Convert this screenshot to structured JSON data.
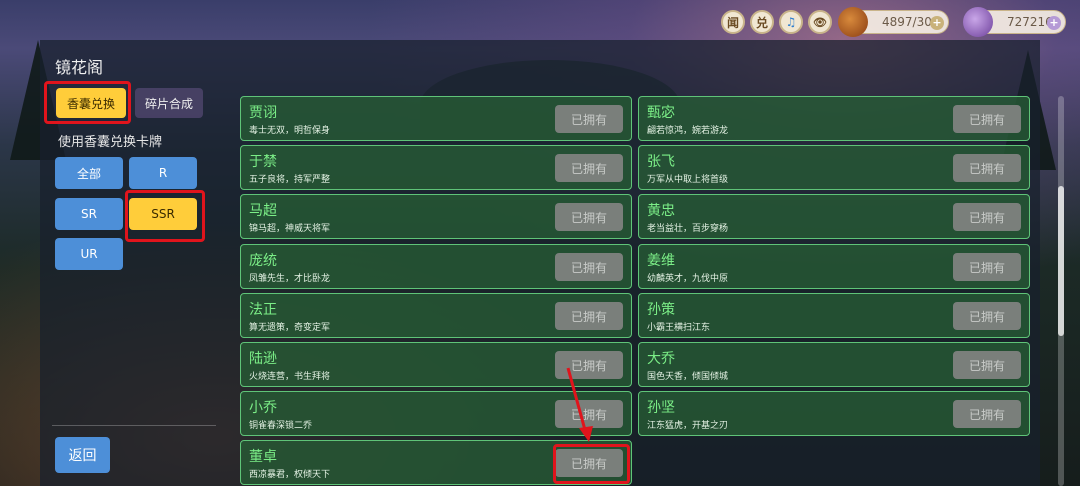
{
  "topbar": {
    "icons": [
      {
        "name": "news-icon",
        "glyph": "闻"
      },
      {
        "name": "redeem-icon",
        "glyph": "兑"
      },
      {
        "name": "music-icon",
        "glyph": "♫"
      },
      {
        "name": "eye-icon",
        "glyph": "👁"
      }
    ],
    "stamina": {
      "value": "4897/30",
      "icon": "coin-bag-icon"
    },
    "currency": {
      "value": "727216",
      "icon": "gem-icon"
    }
  },
  "page_title": "镜花阁",
  "tabs": {
    "active": "香囊兑换",
    "other": "碎片合成"
  },
  "subtitle": "使用香囊兑换卡牌",
  "filters": [
    "全部",
    "R",
    "SR",
    "SSR",
    "UR"
  ],
  "active_filter": "SSR",
  "back_label": "返回",
  "owned_label": "已拥有",
  "cards": [
    {
      "name": "贾诩",
      "desc": "毒士无双，明哲保身"
    },
    {
      "name": "甄宓",
      "desc": "翩若惊鸿，婉若游龙"
    },
    {
      "name": "于禁",
      "desc": "五子良将，持军严整"
    },
    {
      "name": "张飞",
      "desc": "万军从中取上将首级"
    },
    {
      "name": "马超",
      "desc": "锦马超，神威天将军"
    },
    {
      "name": "黄忠",
      "desc": "老当益壮，百步穿杨"
    },
    {
      "name": "庞统",
      "desc": "凤雏先生，才比卧龙"
    },
    {
      "name": "姜维",
      "desc": "幼麟英才，九伐中原"
    },
    {
      "name": "法正",
      "desc": "算无遗策，奇变定军"
    },
    {
      "name": "孙策",
      "desc": "小霸王横扫江东"
    },
    {
      "name": "陆逊",
      "desc": "火烧连营，书生拜将"
    },
    {
      "name": "大乔",
      "desc": "国色天香，倾国倾城"
    },
    {
      "name": "小乔",
      "desc": "铜雀春深锁二乔"
    },
    {
      "name": "孙坚",
      "desc": "江东猛虎，开基之刃"
    },
    {
      "name": "董卓",
      "desc": "西凉暴君，权倾天下"
    }
  ],
  "colors": {
    "accent_yellow": "#ffcd3a",
    "filter_blue": "#4d8fd8",
    "card_green": "#265c34",
    "highlight_red": "#e0141c"
  }
}
